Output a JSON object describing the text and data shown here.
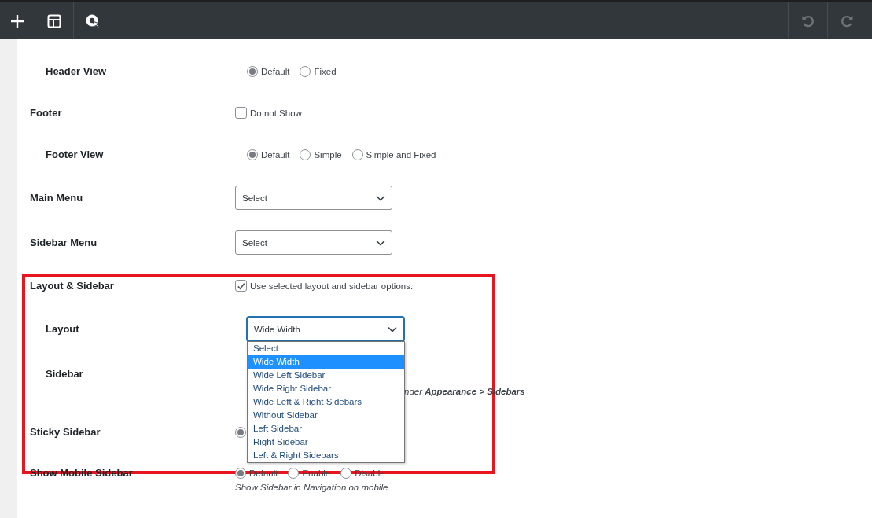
{
  "toolbar": {
    "left_buttons": [
      {
        "kind": "add"
      },
      {
        "kind": "layout"
      },
      {
        "kind": "target"
      }
    ],
    "right_buttons": [
      {
        "kind": "undo",
        "disabled": true
      },
      {
        "kind": "redo",
        "disabled": true
      }
    ]
  },
  "settings": [
    {
      "label": "Header View",
      "indented": true,
      "kind": "radio",
      "options": [
        {
          "label": "Default",
          "selected": true
        },
        {
          "label": "Fixed",
          "selected": false
        }
      ]
    },
    {
      "label": "Footer",
      "indented": false,
      "kind": "checkbox",
      "text": "Do not Show",
      "checked": false
    },
    {
      "label": "Footer View",
      "indented": true,
      "kind": "radio",
      "options": [
        {
          "label": "Default",
          "selected": true
        },
        {
          "label": "Simple",
          "selected": false
        },
        {
          "label": "Simple and Fixed",
          "selected": false
        }
      ]
    },
    {
      "label": "Main Menu",
      "indented": false,
      "kind": "select",
      "value": "Select"
    },
    {
      "label": "Sidebar Menu",
      "indented": false,
      "kind": "select",
      "value": "Select"
    },
    {
      "label": "Layout & Sidebar",
      "indented": false,
      "kind": "checkbox",
      "text": "Use selected layout and sidebar options.",
      "checked": true
    },
    {
      "label": "Layout",
      "indented": true,
      "kind": "select",
      "value": "Wide Width",
      "open": true,
      "options": [
        {
          "label": "Select",
          "selected": false
        },
        {
          "label": "Wide Width",
          "selected": true
        },
        {
          "label": "Wide Left Sidebar",
          "selected": false
        },
        {
          "label": "Wide Right Sidebar",
          "selected": false
        },
        {
          "label": "Wide Left & Right Sidebars",
          "selected": false
        },
        {
          "label": "Without Sidebar",
          "selected": false
        },
        {
          "label": "Left Sidebar",
          "selected": false
        },
        {
          "label": "Right Sidebar",
          "selected": false
        },
        {
          "label": "Left & Right Sidebars",
          "selected": false
        }
      ]
    },
    {
      "label": "Sidebar",
      "indented": true,
      "kind": "note",
      "note": "nder **Appearance > Sidebars**"
    },
    {
      "label": "Sticky Sidebar",
      "indented": false,
      "kind": "radio",
      "options": [
        {
          "selected": true
        }
      ]
    },
    {
      "label": "Show Mobile Sidebar",
      "indented": false,
      "kind": "radio",
      "options": [
        {
          "label": "Default",
          "selected": true
        },
        {
          "label": "Enable",
          "selected": false
        },
        {
          "label": "Disable",
          "selected": false
        }
      ],
      "hint": "Show Sidebar in Navigation on mobile"
    }
  ]
}
